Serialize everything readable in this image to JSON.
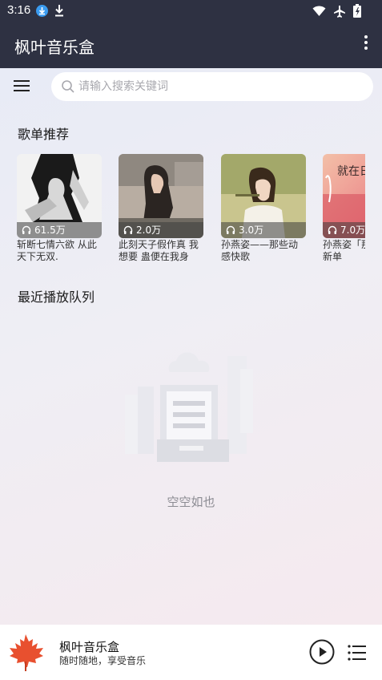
{
  "status_bar": {
    "time": "3:16"
  },
  "app_bar": {
    "title": "枫叶音乐盒"
  },
  "search": {
    "placeholder": "请输入搜索关键词"
  },
  "sections": {
    "recommended": "歌单推荐",
    "recent_queue": "最近播放队列"
  },
  "playlists": [
    {
      "name": "斩断七情六欲 从此天下无双.",
      "plays": "61.5万"
    },
    {
      "name": "此刻天子假作真 我想要 蛊便在我身",
      "plays": "2.0万"
    },
    {
      "name": "孙燕姿——那些动感快歌",
      "plays": "3.0万"
    },
    {
      "name": "孙燕姿「那以后」新单",
      "plays": "7.0万"
    }
  ],
  "empty_state": {
    "text": "空空如也"
  },
  "player": {
    "song": "枫叶音乐盒",
    "subtitle": "随时随地，享受音乐"
  },
  "colors": {
    "app_bar": "#2e3142",
    "maple": "#e8502f"
  }
}
